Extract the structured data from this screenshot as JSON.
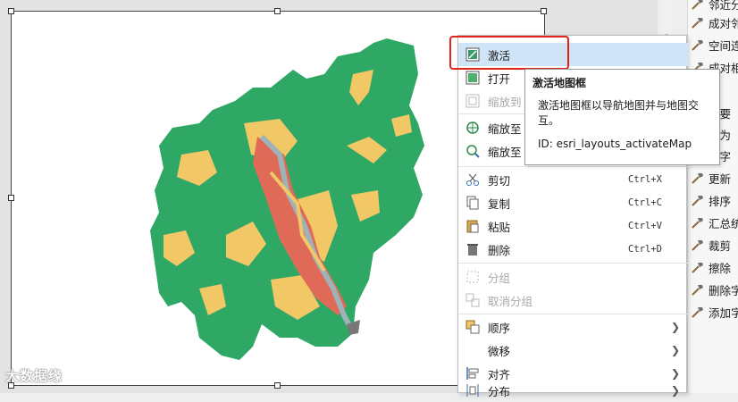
{
  "watermark": "大数据缘",
  "context_menu": {
    "items": [
      {
        "label": "激活",
        "shortcut": "",
        "icon": "activate-map-icon"
      },
      {
        "label": "打开",
        "shortcut": "",
        "icon": "open-icon"
      },
      {
        "label": "缩放到",
        "shortcut": "",
        "icon": "zoom-to-icon"
      },
      {
        "label": "缩放至",
        "shortcut": "",
        "icon": "zoom-to-page-icon"
      },
      {
        "label": "缩放至",
        "shortcut": "",
        "icon": "zoom-to-selected-icon"
      },
      {
        "label": "剪切",
        "shortcut": "Ctrl+X",
        "icon": "scissors-icon"
      },
      {
        "label": "复制",
        "shortcut": "Ctrl+C",
        "icon": "copy-icon"
      },
      {
        "label": "粘贴",
        "shortcut": "Ctrl+V",
        "icon": "paste-icon"
      },
      {
        "label": "删除",
        "shortcut": "Ctrl+D",
        "icon": "trash-icon"
      },
      {
        "label": "分组",
        "shortcut": "",
        "icon": "group-icon"
      },
      {
        "label": "取消分组",
        "shortcut": "",
        "icon": "ungroup-icon"
      },
      {
        "label": "顺序",
        "shortcut": "",
        "icon": "order-icon"
      },
      {
        "label": "微移",
        "shortcut": "",
        "icon": ""
      },
      {
        "label": "对齐",
        "shortcut": "",
        "icon": "align-icon"
      },
      {
        "label": "分布",
        "shortcut": "",
        "icon": "distribute-icon"
      }
    ]
  },
  "tooltip": {
    "title": "激活地图框",
    "desc_line1": "激活地图框以导航地图并与地图交",
    "desc_line2": "互。",
    "id": "ID: esri_layouts_activateMap"
  },
  "right_panel": {
    "items": [
      "邻近分",
      "成对邻",
      "空间连",
      "成对相",
      "",
      "制要",
      "出为",
      "算字",
      "更新",
      "排序",
      "汇总统",
      "裁剪",
      "擦除",
      "删除字",
      "添加字"
    ]
  },
  "colors": {
    "highlight": "#cfe5f7",
    "red_frame": "#e0241b",
    "map_green": "#2fa865",
    "map_yellow": "#f2c867",
    "map_road": "#9fb2b8",
    "map_urban": "#e06a58"
  }
}
